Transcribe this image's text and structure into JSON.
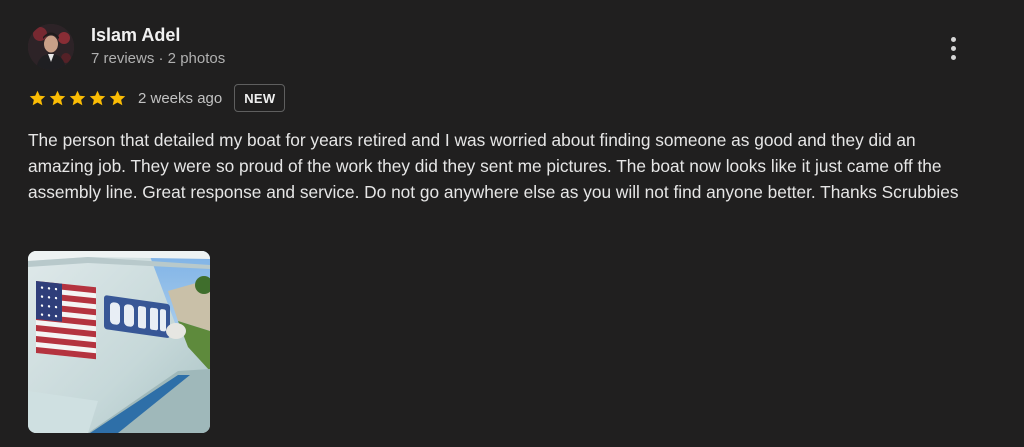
{
  "review": {
    "author": {
      "name": "Islam Adel",
      "meta": "7 reviews · 2 photos",
      "avatar_icon": "user-avatar"
    },
    "more_icon": "more-vertical-icon",
    "rating": 5,
    "rating_max": 5,
    "star_color": "#fbbc04",
    "date": "2 weeks ago",
    "badge": "NEW",
    "text": "The person that detailed my boat for years retired and I was worried about finding someone as good and they did an amazing job. They were so proud of the work they did they sent me pictures. The boat now looks like it just came off the assembly line. Great response and service. Do not go anywhere else as you will not find anyone better. Thanks Scrubbies",
    "photos_icon": "boat-photo"
  }
}
